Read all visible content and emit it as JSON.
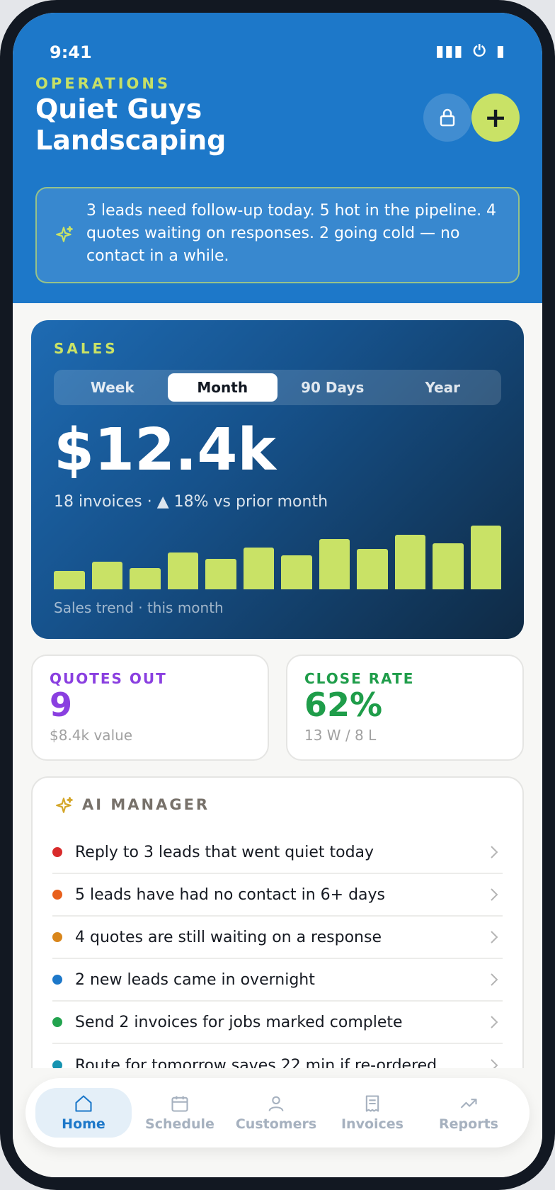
{
  "status_bar": {
    "time": "9:41"
  },
  "header": {
    "eyebrow": "OPERATIONS",
    "title": "Quiet Guys Landscaping",
    "add_label": "+",
    "briefing": "3 leads need follow-up today. 5 hot in the pipeline. 4 quotes waiting on responses. 2 going cold — no contact in a while."
  },
  "sales": {
    "label": "SALES",
    "periods": [
      "Week",
      "Month",
      "90 Days",
      "Year"
    ],
    "active_period": "Month",
    "total": "$12.4k",
    "subtitle": "18 invoices · ▲ 18% vs prior month",
    "trend_label": "Sales trend · this month",
    "bar_color": "#c9e266",
    "trend_values": [
      3,
      4.5,
      3.5,
      6,
      5,
      6.8,
      5.6,
      8.2,
      6.6,
      8.9,
      7.5,
      10.4
    ]
  },
  "stats": {
    "quotes": {
      "label": "QUOTES OUT",
      "value": "9",
      "sub": "$8.4k value",
      "color": "#8a3fe0"
    },
    "close_rate": {
      "label": "CLOSE RATE",
      "value": "62%",
      "sub": "13 W / 8 L",
      "color": "#1f9d4a"
    }
  },
  "ai_manager": {
    "title": "AI MANAGER",
    "items": [
      {
        "text": "Reply to 3 leads that went quiet today",
        "color": "#d82b2b"
      },
      {
        "text": "5 leads have had no contact in 6+ days",
        "color": "#e8601c"
      },
      {
        "text": "4 quotes are still waiting on a response",
        "color": "#d9861b"
      },
      {
        "text": "2 new leads came in overnight",
        "color": "#1d78c9"
      },
      {
        "text": "Send 2 invoices for jobs marked complete",
        "color": "#22a34e"
      },
      {
        "text": "Route for tomorrow saves 22 min if re-ordered",
        "color": "#1693b0"
      }
    ]
  },
  "nav": {
    "active": "Home",
    "items": [
      {
        "label": "Home",
        "icon": "home-icon"
      },
      {
        "label": "Schedule",
        "icon": "calendar-icon"
      },
      {
        "label": "Customers",
        "icon": "person-icon"
      },
      {
        "label": "Invoices",
        "icon": "receipt-icon"
      },
      {
        "label": "Reports",
        "icon": "trend-icon"
      }
    ]
  },
  "colors": {
    "brand_blue": "#1d78c9",
    "accent_lime": "#c9e266",
    "ink": "#121822"
  }
}
